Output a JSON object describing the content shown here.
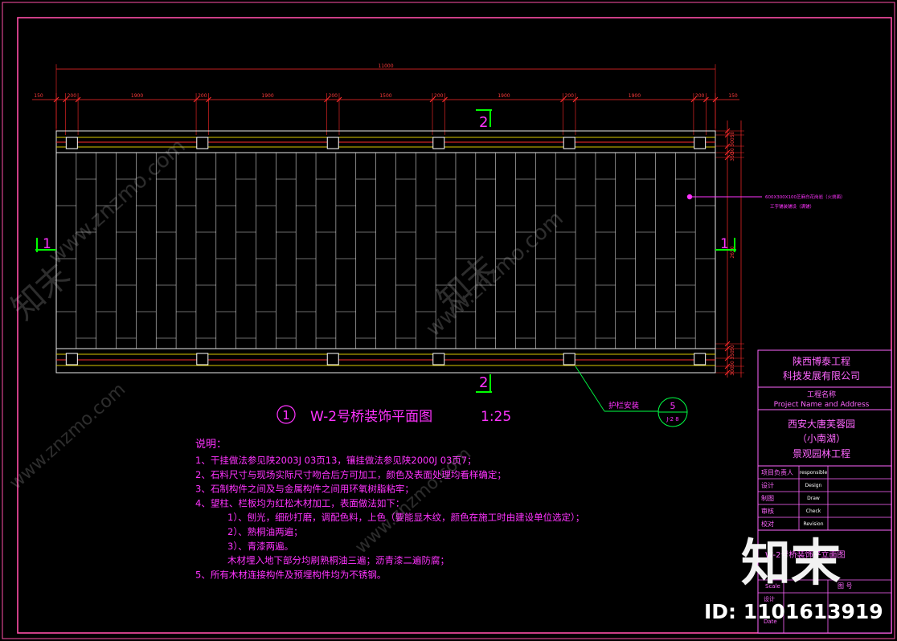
{
  "colors": {
    "background": "#000000",
    "frame": "#ff4fa8",
    "outline": "#ffffff",
    "dimension": "#ff2a2a",
    "annotation": "#ff33ff",
    "section_marker": "#00ff00",
    "rail_yellow": "#d8c800",
    "leader": "#00ff44"
  },
  "dimensions": {
    "total": "11000",
    "segments": [
      "150",
      "200",
      "1900",
      "200",
      "1900",
      "200",
      "1500",
      "200",
      "1900",
      "200",
      "1900",
      "200",
      "150"
    ]
  },
  "right_dims": [
    "50",
    "300",
    "30",
    "350",
    "2650",
    "50",
    "350",
    "30",
    "300"
  ],
  "section_marks": {
    "top": "2",
    "bottom": "2",
    "left": "1",
    "right": "1"
  },
  "callout": {
    "line1": "600X300X100芝麻白花岗岩（火烧面）",
    "line2": "工字铺装铺设（满铺）"
  },
  "detail": {
    "label": "护栏安装",
    "num": "5",
    "sheet": "J-2 8"
  },
  "drawing_title": {
    "num": "1",
    "text": "W-2号桥装饰平面图",
    "scale": "1:25"
  },
  "notes": {
    "heading": "说明：",
    "lines": [
      "1、干挂做法参见陕2003J 03页13，镶挂做法参见陕2000J 03页7；",
      "2、石料尺寸与现场实际尺寸吻合后方可加工，颜色及表面处理均看样确定；",
      "3、石制构件之间及与金属构件之间用环氧树脂粘牢；",
      "4、望柱、栏板均为红松木材加工，表面做法如下：",
      "1）、刨光，细砂打磨，调配色料，上色（要能显木纹，颜色在施工时由建设单位选定）；",
      "2）、熟桐油两遍；",
      "3）、青漆两遍。",
      "木材埋入地下部分均刷熟桐油三遍；沥青漆二遍防腐；",
      "5、所有木材连接构件及预埋构件均为不锈钢。"
    ]
  },
  "title_block": {
    "company_1": "陕西博泰工程",
    "company_2": "科技发展有限公司",
    "project_label_cn": "工程名称",
    "project_label_en": "Project Name and Address",
    "project_1": "西安大唐芙蓉园",
    "project_2": "（小南湖）",
    "project_3": "景观园林工程",
    "rows": [
      {
        "cn": "项目负责人",
        "en": "responsible"
      },
      {
        "cn": "设计",
        "en": "Design"
      },
      {
        "cn": "制图",
        "en": "Draw"
      },
      {
        "cn": "审核",
        "en": "Check"
      },
      {
        "cn": "校对",
        "en": "Revision"
      }
    ],
    "drawing_name": "W-2号桥装饰平立面图",
    "scale_label": "Scale",
    "sheet_label": "图    号",
    "design_label": "设计",
    "date_label": "Date"
  },
  "watermarks": {
    "text": "www.znzmo.com",
    "brand": "知末",
    "id": "ID: 1101613919"
  }
}
